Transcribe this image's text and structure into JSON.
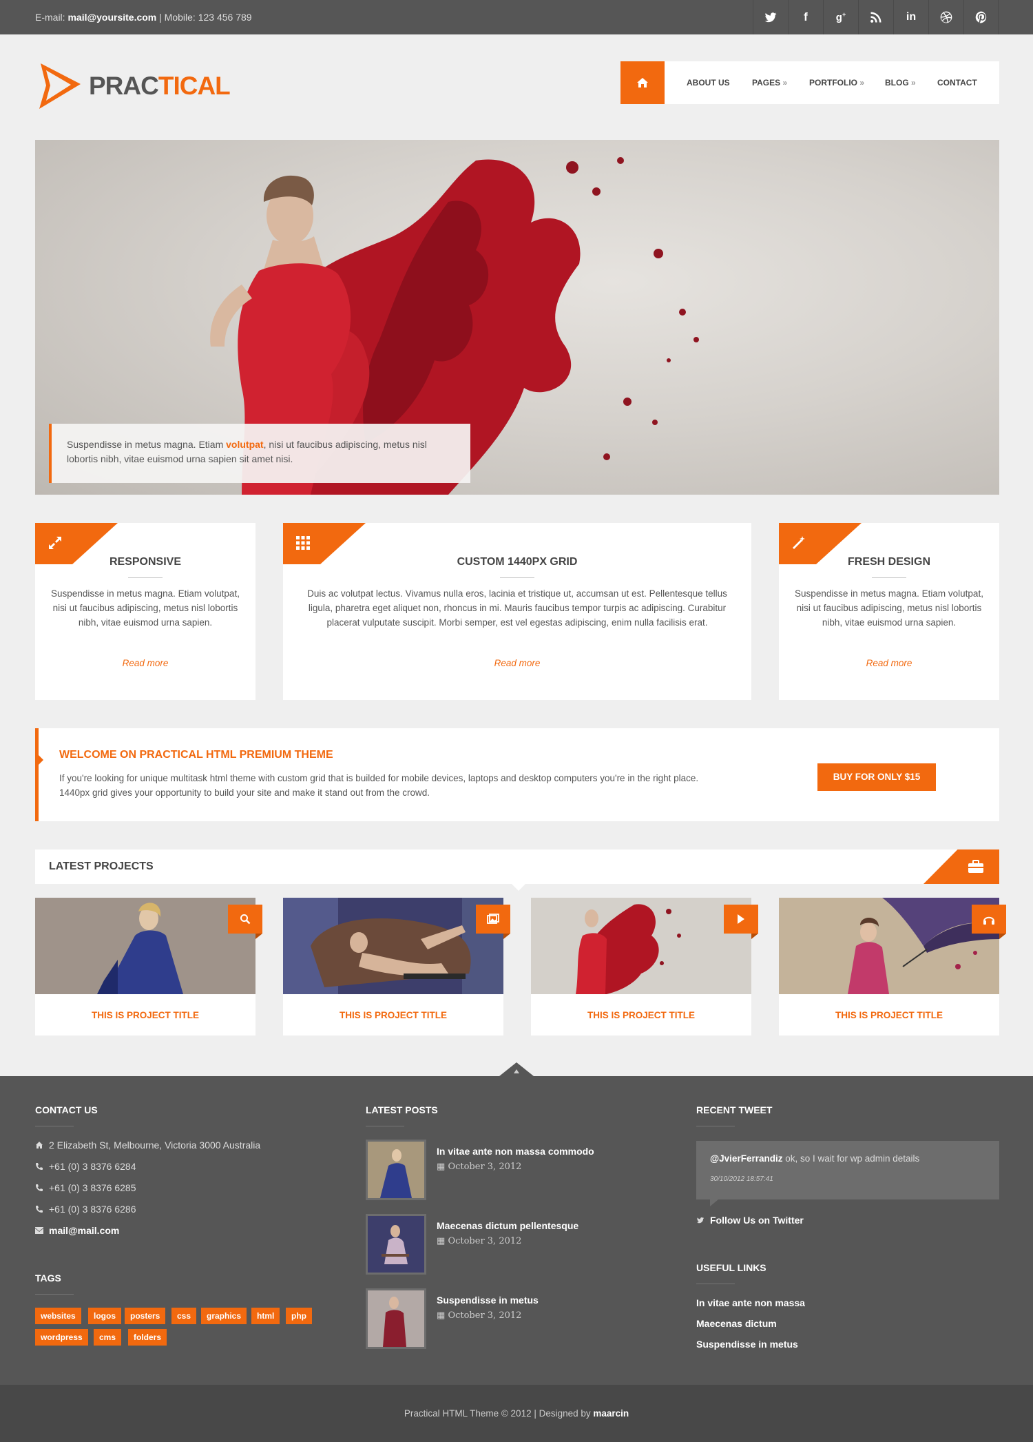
{
  "topbar": {
    "email_label": "E-mail:",
    "email": "mail@yoursite.com",
    "mobile_label": "| Mobile: 123 456 789",
    "social": [
      "twitter-icon",
      "facebook-icon",
      "google-plus-icon",
      "rss-icon",
      "linkedin-icon",
      "dribbble-icon",
      "pinterest-icon"
    ]
  },
  "logo": {
    "part1": "PRAC",
    "part2": "TICAL"
  },
  "nav": {
    "items": [
      {
        "label": "ABOUT US",
        "arrow": ""
      },
      {
        "label": "PAGES",
        "arrow": "»"
      },
      {
        "label": "PORTFOLIO",
        "arrow": "»"
      },
      {
        "label": "BLOG",
        "arrow": "»"
      },
      {
        "label": "CONTACT",
        "arrow": ""
      }
    ]
  },
  "hero": {
    "caption_pre": "Suspendisse in metus magna. Etiam ",
    "caption_hl": "volutpat",
    "caption_post": ", nisi ut faucibus adipiscing, metus nisl lobortis nibh, vitae euismod urna sapien sit amet nisi."
  },
  "features": [
    {
      "title": "RESPONSIVE",
      "icon": "expand-icon",
      "text": "Suspendisse in metus magna. Etiam volutpat, nisi ut faucibus adipiscing, metus nisl lobortis nibh, vitae euismod urna sapien.",
      "more": "Read more"
    },
    {
      "title": "CUSTOM 1440PX GRID",
      "icon": "grid-icon",
      "text": "Duis ac volutpat lectus. Vivamus nulla eros, lacinia et tristique ut, accumsan ut est. Pellentesque tellus ligula, pharetra eget aliquet non, rhoncus in mi. Mauris faucibus tempor turpis ac adipiscing. Curabitur placerat vulputate suscipit. Morbi semper, est vel egestas adipiscing, enim nulla facilisis erat.",
      "more": "Read more"
    },
    {
      "title": "FRESH DESIGN",
      "icon": "magic-wand-icon",
      "text": "Suspendisse in metus magna. Etiam volutpat, nisi ut faucibus adipiscing, metus nisl lobortis nibh, vitae euismod urna sapien.",
      "more": "Read more"
    }
  ],
  "welcome": {
    "title": "WELCOME ON PRACTICAL HTML PREMIUM THEME",
    "text": "If you're looking for unique multitask html theme with custom grid that is builded for mobile devices, laptops and desktop computers you're in the right place. 1440px grid gives your opportunity to build your site and make it stand out from the crowd.",
    "button": "BUY FOR ONLY $15"
  },
  "projects": {
    "heading": "LATEST PROJECTS",
    "items": [
      {
        "title": "THIS IS PROJECT TITLE",
        "icon": "search-icon"
      },
      {
        "title": "THIS IS PROJECT TITLE",
        "icon": "image-icon"
      },
      {
        "title": "THIS IS PROJECT TITLE",
        "icon": "play-icon"
      },
      {
        "title": "THIS IS PROJECT TITLE",
        "icon": "headphones-icon"
      }
    ]
  },
  "footer": {
    "contact": {
      "heading": "CONTACT US",
      "address": "2 Elizabeth St, Melbourne, Victoria 3000 Australia",
      "phones": [
        "+61 (0) 3 8376 6284",
        "+61 (0) 3 8376 6285",
        "+61 (0) 3 8376 6286"
      ],
      "email": "mail@mail.com"
    },
    "tags": {
      "heading": "TAGS",
      "items": [
        "websites",
        "logos",
        "posters",
        "css",
        "graphics",
        "html",
        "php",
        "wordpress",
        "cms",
        "folders"
      ]
    },
    "posts": {
      "heading": "LATEST POSTS",
      "items": [
        {
          "title": "In vitae ante non massa commodo",
          "date": "October 3, 2012"
        },
        {
          "title": "Maecenas dictum pellentesque",
          "date": "October 3, 2012"
        },
        {
          "title": "Suspendisse in metus",
          "date": "October 3, 2012"
        }
      ]
    },
    "tweet": {
      "heading": "RECENT TWEET",
      "user": "@JvierFerrandiz",
      "text": " ok, so I wait for wp admin details",
      "time": "30/10/2012 18:57:41",
      "follow": "Follow Us on Twitter"
    },
    "links": {
      "heading": "USEFUL LINKS",
      "items": [
        "In vitae ante non massa",
        "Maecenas dictum",
        "Suspendisse in metus"
      ]
    }
  },
  "bottom": {
    "text": "Practical HTML Theme © 2012 | Designed by ",
    "author": "maarcin"
  },
  "colors": {
    "accent": "#f2690f",
    "dark": "#565656",
    "darker": "#484848",
    "bg": "#efefef"
  }
}
